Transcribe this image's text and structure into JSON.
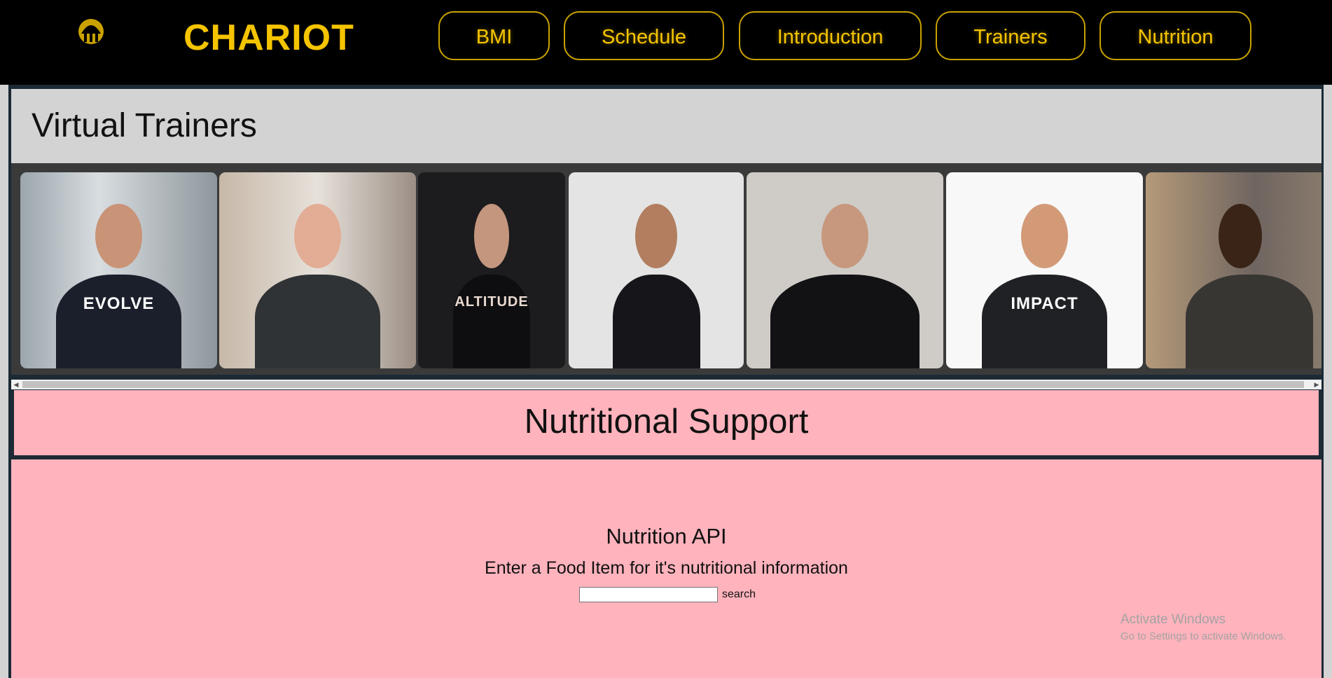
{
  "header": {
    "brand": "CHARIOT",
    "logo_icon": "helmet-logo-icon",
    "nav": [
      {
        "label": "BMI"
      },
      {
        "label": "Schedule"
      },
      {
        "label": "Introduction"
      },
      {
        "label": "Trainers"
      },
      {
        "label": "Nutrition"
      }
    ],
    "colors": {
      "accent": "#f5c400",
      "background": "#000000"
    }
  },
  "trainers": {
    "title": "Virtual Trainers",
    "photos": [
      {
        "name": "trainer-evolve",
        "shirt_text": "EVOLVE"
      },
      {
        "name": "trainer-young-man",
        "shirt_text": ""
      },
      {
        "name": "trainer-altitude",
        "shirt_text": "ALTITUDE"
      },
      {
        "name": "trainer-woman-smiling",
        "shirt_text": ""
      },
      {
        "name": "trainer-muscular",
        "shirt_text": ""
      },
      {
        "name": "trainer-impact",
        "shirt_text": "IMPACT"
      },
      {
        "name": "trainer-gym",
        "shirt_text": ""
      }
    ]
  },
  "nutrition": {
    "title": "Nutritional Support",
    "api_title": "Nutrition API",
    "api_subtitle": "Enter a Food Item for it's nutritional information",
    "search_value": "",
    "search_button": "search",
    "panel_color": "#ffb3bd"
  },
  "watermark": {
    "line1": "Activate Windows",
    "line2": "Go to Settings to activate Windows."
  }
}
